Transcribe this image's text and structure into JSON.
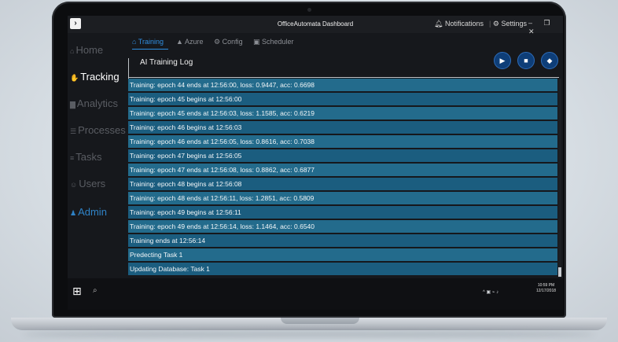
{
  "window": {
    "title": "OfficeAutomata Dashboard",
    "notifications_label": "Notifications",
    "settings_label": "Settings",
    "separator": "|",
    "window_buttons": "– ❐ ✕"
  },
  "sidebar": {
    "items": [
      {
        "icon": "home-icon",
        "label": "Home"
      },
      {
        "icon": "tracking-icon",
        "label": "Tracking"
      },
      {
        "icon": "analytics-icon",
        "label": "Analytics"
      },
      {
        "icon": "processes-icon",
        "label": "Processes"
      },
      {
        "icon": "tasks-icon",
        "label": "Tasks"
      },
      {
        "icon": "users-icon",
        "label": "Users"
      },
      {
        "icon": "admin-icon",
        "label": "Admin"
      }
    ],
    "active_item": "Admin",
    "colors": {
      "active": "#2f83c7",
      "inactive": "#5a5d63"
    }
  },
  "tabs": [
    {
      "icon": "home-icon",
      "label": "Training",
      "active": true
    },
    {
      "icon": "azure-icon",
      "label": "Azure",
      "active": false
    },
    {
      "icon": "gear-icon",
      "label": "Config",
      "active": false
    },
    {
      "icon": "calendar-icon",
      "label": "Scheduler",
      "active": false
    }
  ],
  "log": {
    "title": "AI Training Log",
    "controls": [
      {
        "icon": "play-icon",
        "glyph": "▶"
      },
      {
        "icon": "stop-icon",
        "glyph": "■"
      },
      {
        "icon": "eraser-icon",
        "glyph": "◆"
      }
    ],
    "entries": [
      "Training: epoch 44 ends at 12:56:00, loss: 0.9447, acc: 0.6698",
      "Training: epoch 45 begins at 12:56:00",
      "Training: epoch 45 ends at 12:56:03, loss: 1.1585, acc: 0.6219",
      "Training: epoch 46 begins at 12:56:03",
      "Training: epoch 46 ends at 12:56:05, loss: 0.8616, acc: 0.7038",
      "Training: epoch 47 begins at 12:56:05",
      "Training: epoch 47 ends at 12:56:08, loss: 0.8862, acc: 0.6877",
      "Training: epoch 48 begins at 12:56:08",
      "Training: epoch 48 ends at 12:56:11, loss: 1.2851, acc: 0.5809",
      "Training: epoch 49 begins at 12:56:11",
      "Training: epoch 49 ends at 12:56:14, loss: 1.1464, acc: 0.6540",
      "Training ends at 12:56:14",
      "Predecting Task 1",
      "Updating Database: Task 1"
    ],
    "row_colors": [
      "#236b8c",
      "#1b5d7f"
    ]
  },
  "taskbar": {
    "start_glyph": "⊞",
    "search_glyph": "⌕",
    "tray_text": "^ ▣ ⌁ ♪",
    "time": "10:59 PM",
    "date": "12/17/2018"
  }
}
